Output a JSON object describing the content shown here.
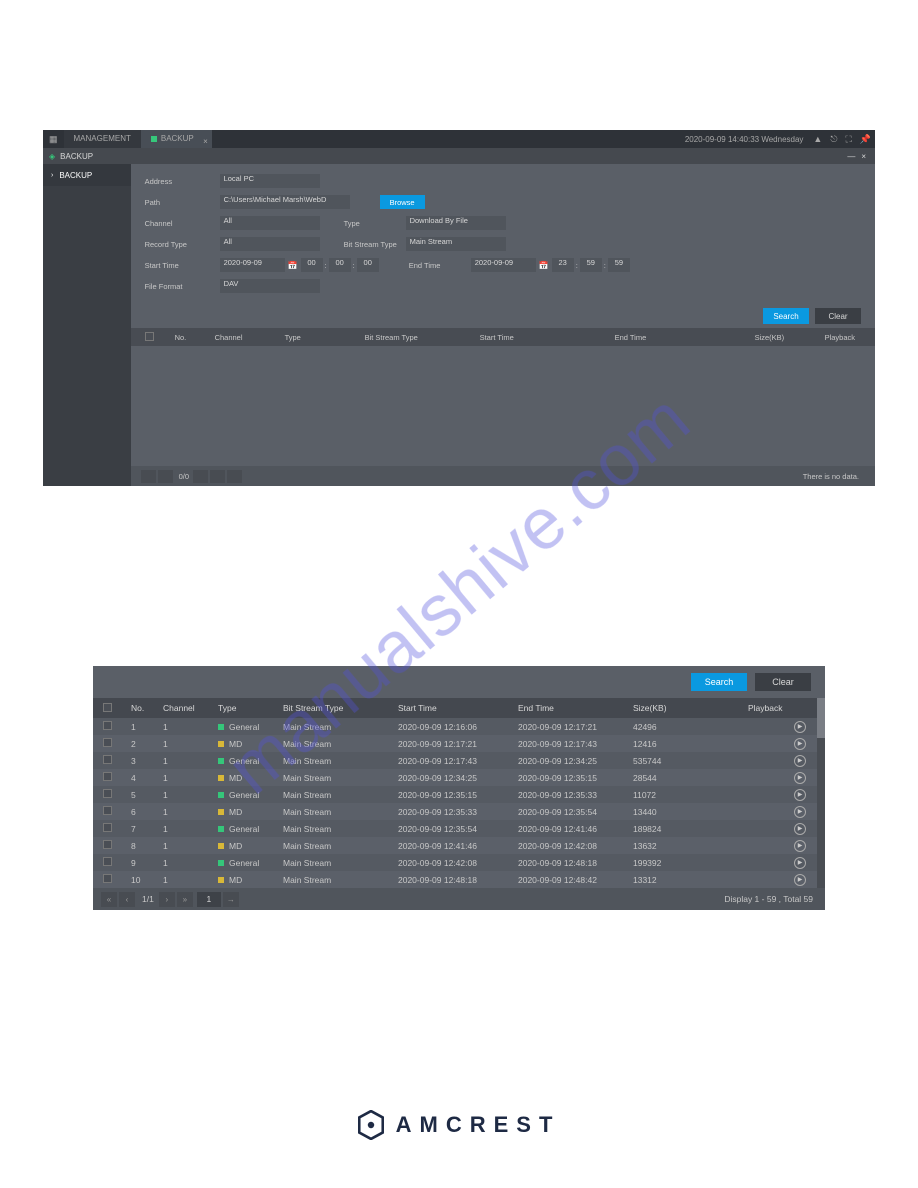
{
  "topbar": {
    "management": "MANAGEMENT",
    "backup_tab": "BACKUP",
    "datetime": "2020-09-09 14:40:33 Wednesday"
  },
  "subbar": {
    "title": "BACKUP"
  },
  "sidebar": {
    "item": "BACKUP"
  },
  "form": {
    "address_label": "Address",
    "address_value": "Local PC",
    "path_label": "Path",
    "path_value": "C:\\Users\\Michael Marsh\\WebD",
    "browse": "Browse",
    "channel_label": "Channel",
    "channel_value": "All",
    "type_label": "Type",
    "type_value": "Download By File",
    "record_type_label": "Record Type",
    "record_type_value": "All",
    "bst_label": "Bit Stream Type",
    "bst_value": "Main Stream",
    "start_label": "Start Time",
    "start_date": "2020-09-09",
    "start_h": "00",
    "start_m": "00",
    "start_s": "00",
    "end_label": "End Time",
    "end_date": "2020-09-09",
    "end_h": "23",
    "end_m": "59",
    "end_s": "59",
    "file_format_label": "File Format",
    "file_format_value": "DAV"
  },
  "buttons": {
    "search": "Search",
    "clear": "Clear"
  },
  "headers": {
    "no": "No.",
    "channel": "Channel",
    "type": "Type",
    "bst": "Bit Stream Type",
    "start": "Start Time",
    "end": "End Time",
    "size": "Size(KB)",
    "playback": "Playback"
  },
  "footer1": {
    "page": "0/0",
    "nodata": "There is no data."
  },
  "rows": [
    {
      "no": "1",
      "ch": "1",
      "type": "General",
      "dot": "g",
      "bst": "Main Stream",
      "st": "2020-09-09 12:16:06",
      "et": "2020-09-09 12:17:21",
      "sz": "42496"
    },
    {
      "no": "2",
      "ch": "1",
      "type": "MD",
      "dot": "y",
      "bst": "Main Stream",
      "st": "2020-09-09 12:17:21",
      "et": "2020-09-09 12:17:43",
      "sz": "12416"
    },
    {
      "no": "3",
      "ch": "1",
      "type": "General",
      "dot": "g",
      "bst": "Main Stream",
      "st": "2020-09-09 12:17:43",
      "et": "2020-09-09 12:34:25",
      "sz": "535744"
    },
    {
      "no": "4",
      "ch": "1",
      "type": "MD",
      "dot": "y",
      "bst": "Main Stream",
      "st": "2020-09-09 12:34:25",
      "et": "2020-09-09 12:35:15",
      "sz": "28544"
    },
    {
      "no": "5",
      "ch": "1",
      "type": "General",
      "dot": "g",
      "bst": "Main Stream",
      "st": "2020-09-09 12:35:15",
      "et": "2020-09-09 12:35:33",
      "sz": "11072"
    },
    {
      "no": "6",
      "ch": "1",
      "type": "MD",
      "dot": "y",
      "bst": "Main Stream",
      "st": "2020-09-09 12:35:33",
      "et": "2020-09-09 12:35:54",
      "sz": "13440"
    },
    {
      "no": "7",
      "ch": "1",
      "type": "General",
      "dot": "g",
      "bst": "Main Stream",
      "st": "2020-09-09 12:35:54",
      "et": "2020-09-09 12:41:46",
      "sz": "189824"
    },
    {
      "no": "8",
      "ch": "1",
      "type": "MD",
      "dot": "y",
      "bst": "Main Stream",
      "st": "2020-09-09 12:41:46",
      "et": "2020-09-09 12:42:08",
      "sz": "13632"
    },
    {
      "no": "9",
      "ch": "1",
      "type": "General",
      "dot": "g",
      "bst": "Main Stream",
      "st": "2020-09-09 12:42:08",
      "et": "2020-09-09 12:48:18",
      "sz": "199392"
    },
    {
      "no": "10",
      "ch": "1",
      "type": "MD",
      "dot": "y",
      "bst": "Main Stream",
      "st": "2020-09-09 12:48:18",
      "et": "2020-09-09 12:48:42",
      "sz": "13312"
    }
  ],
  "footer2": {
    "page": "1/1",
    "goto": "1",
    "display": "Display 1 - 59 , Total 59"
  },
  "watermark": "manualshive.com",
  "logo": "AMCREST"
}
